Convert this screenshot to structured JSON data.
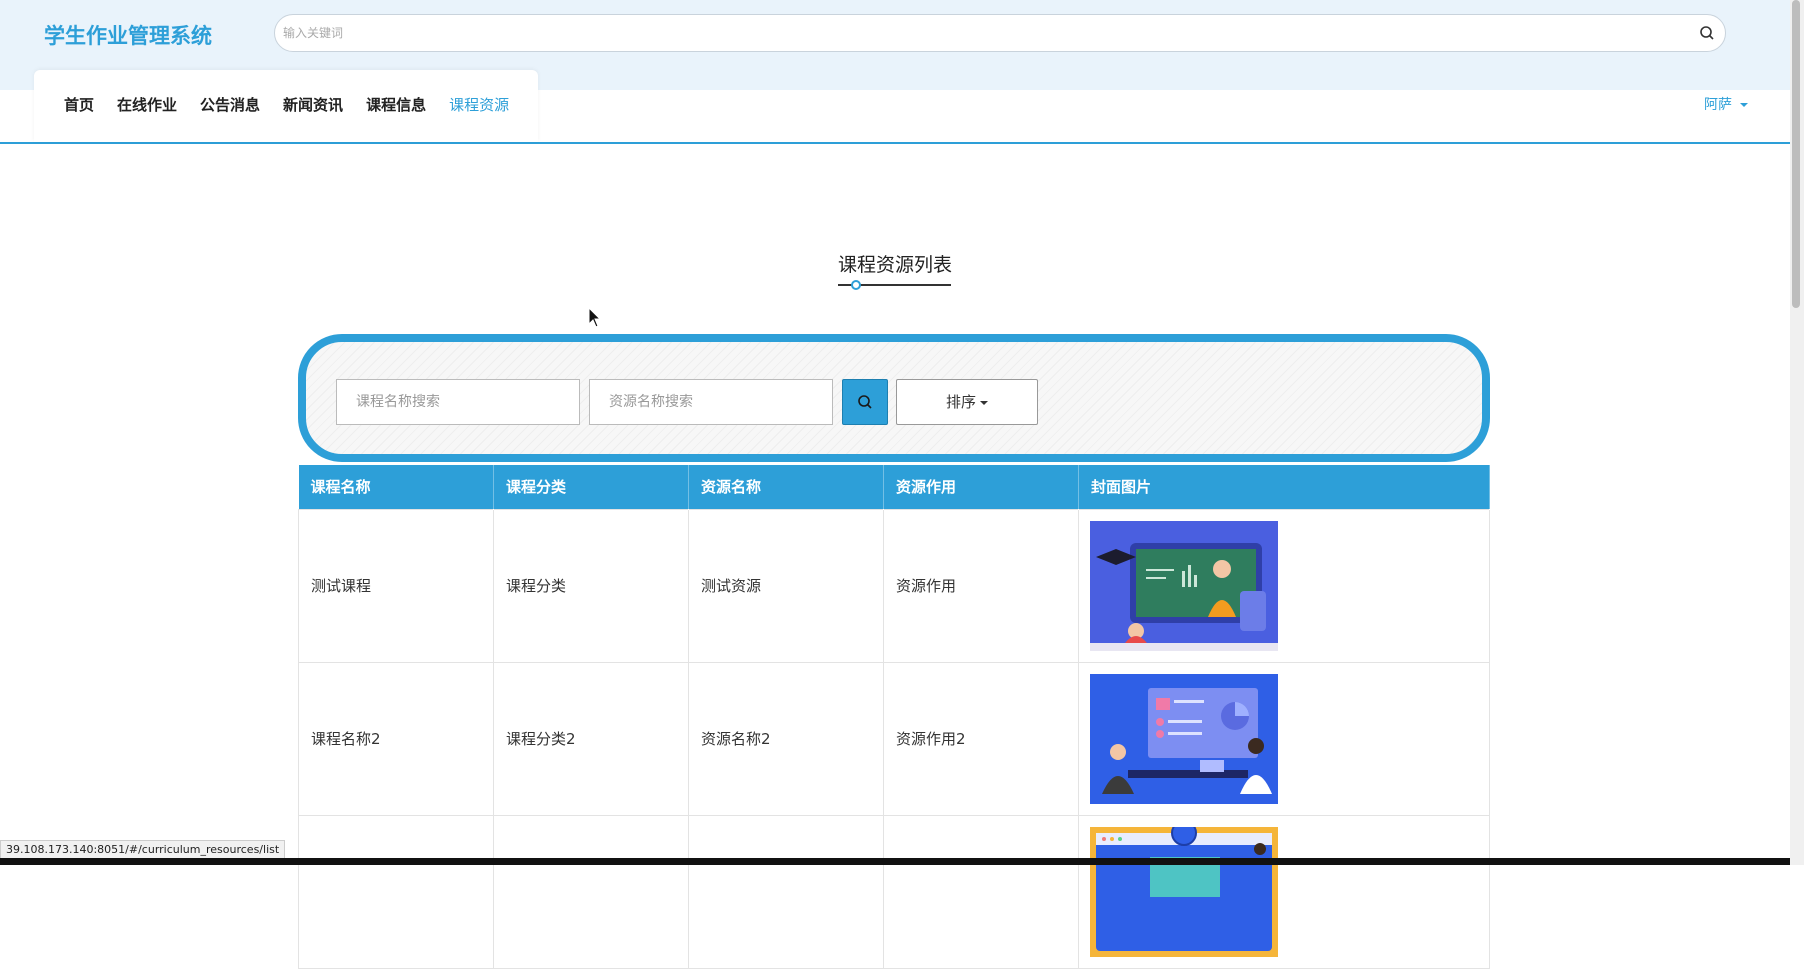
{
  "header": {
    "brand": "学生作业管理系统",
    "search_placeholder": "输入关键词",
    "search_icon": "search-icon"
  },
  "nav": {
    "items": [
      {
        "label": "首页",
        "active": false
      },
      {
        "label": "在线作业",
        "active": false
      },
      {
        "label": "公告消息",
        "active": false
      },
      {
        "label": "新闻资讯",
        "active": false
      },
      {
        "label": "课程信息",
        "active": false
      },
      {
        "label": "课程资源",
        "active": true
      }
    ],
    "user": "阿萨"
  },
  "page": {
    "title": "课程资源列表"
  },
  "filters": {
    "course_placeholder": "课程名称搜索",
    "resource_placeholder": "资源名称搜索",
    "search_icon": "search-icon",
    "sort_label": "排序"
  },
  "table": {
    "headers": [
      "课程名称",
      "课程分类",
      "资源名称",
      "资源作用",
      "封面图片"
    ],
    "rows": [
      {
        "course": "测试课程",
        "category": "课程分类",
        "resource": "测试资源",
        "purpose": "资源作用",
        "cover": "online-class-teacher-image"
      },
      {
        "course": "课程名称2",
        "category": "课程分类2",
        "resource": "资源名称2",
        "purpose": "资源作用2",
        "cover": "meeting-presentation-image"
      },
      {
        "course": "",
        "category": "",
        "resource": "",
        "purpose": "",
        "cover": "video-call-image"
      }
    ]
  },
  "status_url": "39.108.173.140:8051/#/curriculum_resources/list",
  "colors": {
    "accent": "#2d9fd8",
    "topbar_bg": "#e9f3fb"
  }
}
